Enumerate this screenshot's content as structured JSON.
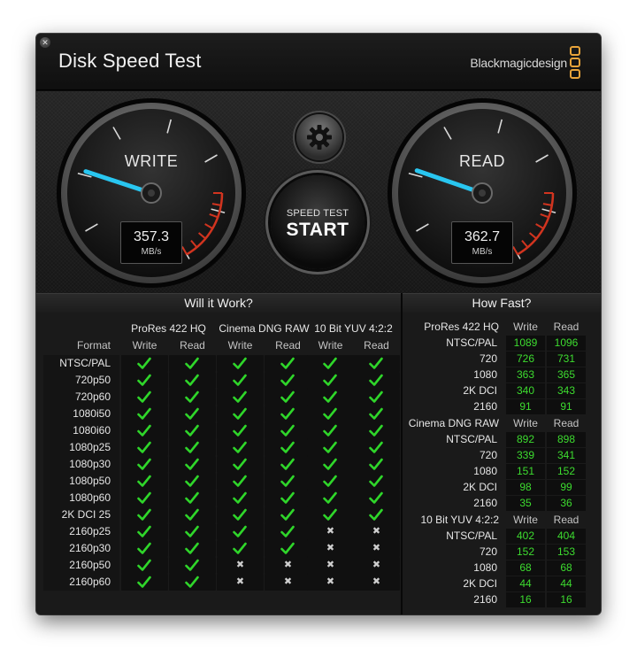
{
  "app": {
    "title": "Disk Speed Test",
    "brand": "Blackmagicdesign",
    "close_icon": "close-icon",
    "accent_needle": "#29c6f0",
    "redline_color": "#d1341f",
    "pass_color": "#2fd62a"
  },
  "gauges": {
    "write": {
      "label": "WRITE",
      "value": "357.3",
      "unit": "MB/s",
      "reading": 357.3
    },
    "read": {
      "label": "READ",
      "value": "362.7",
      "unit": "MB/s",
      "reading": 362.7
    }
  },
  "controls": {
    "settings_icon": "gear-icon",
    "start_sub": "SPEED TEST",
    "start_main": "START"
  },
  "will_it_work": {
    "title": "Will it Work?",
    "format_label": "Format",
    "groups": [
      "ProRes 422 HQ",
      "Cinema DNG RAW",
      "10 Bit YUV 4:2:2"
    ],
    "subheaders": [
      "Write",
      "Read"
    ],
    "rows": [
      {
        "format": "NTSC/PAL",
        "cells": [
          1,
          1,
          1,
          1,
          1,
          1
        ]
      },
      {
        "format": "720p50",
        "cells": [
          1,
          1,
          1,
          1,
          1,
          1
        ]
      },
      {
        "format": "720p60",
        "cells": [
          1,
          1,
          1,
          1,
          1,
          1
        ]
      },
      {
        "format": "1080i50",
        "cells": [
          1,
          1,
          1,
          1,
          1,
          1
        ]
      },
      {
        "format": "1080i60",
        "cells": [
          1,
          1,
          1,
          1,
          1,
          1
        ]
      },
      {
        "format": "1080p25",
        "cells": [
          1,
          1,
          1,
          1,
          1,
          1
        ]
      },
      {
        "format": "1080p30",
        "cells": [
          1,
          1,
          1,
          1,
          1,
          1
        ]
      },
      {
        "format": "1080p50",
        "cells": [
          1,
          1,
          1,
          1,
          1,
          1
        ]
      },
      {
        "format": "1080p60",
        "cells": [
          1,
          1,
          1,
          1,
          1,
          1
        ]
      },
      {
        "format": "2K DCI 25",
        "cells": [
          1,
          1,
          1,
          1,
          1,
          1
        ]
      },
      {
        "format": "2160p25",
        "cells": [
          1,
          1,
          1,
          1,
          0,
          0
        ]
      },
      {
        "format": "2160p30",
        "cells": [
          1,
          1,
          1,
          1,
          0,
          0
        ]
      },
      {
        "format": "2160p50",
        "cells": [
          1,
          1,
          0,
          0,
          0,
          0
        ]
      },
      {
        "format": "2160p60",
        "cells": [
          1,
          1,
          0,
          0,
          0,
          0
        ]
      }
    ]
  },
  "how_fast": {
    "title": "How Fast?",
    "groups": [
      {
        "name": "ProRes 422 HQ",
        "write_label": "Write",
        "read_label": "Read",
        "rows": [
          {
            "format": "NTSC/PAL",
            "write": "1089",
            "read": "1096"
          },
          {
            "format": "720",
            "write": "726",
            "read": "731"
          },
          {
            "format": "1080",
            "write": "363",
            "read": "365"
          },
          {
            "format": "2K DCI",
            "write": "340",
            "read": "343"
          },
          {
            "format": "2160",
            "write": "91",
            "read": "91"
          }
        ]
      },
      {
        "name": "Cinema DNG RAW",
        "write_label": "Write",
        "read_label": "Read",
        "rows": [
          {
            "format": "NTSC/PAL",
            "write": "892",
            "read": "898"
          },
          {
            "format": "720",
            "write": "339",
            "read": "341"
          },
          {
            "format": "1080",
            "write": "151",
            "read": "152"
          },
          {
            "format": "2K DCI",
            "write": "98",
            "read": "99"
          },
          {
            "format": "2160",
            "write": "35",
            "read": "36"
          }
        ]
      },
      {
        "name": "10 Bit YUV 4:2:2",
        "write_label": "Write",
        "read_label": "Read",
        "rows": [
          {
            "format": "NTSC/PAL",
            "write": "402",
            "read": "404"
          },
          {
            "format": "720",
            "write": "152",
            "read": "153"
          },
          {
            "format": "1080",
            "write": "68",
            "read": "68"
          },
          {
            "format": "2K DCI",
            "write": "44",
            "read": "44"
          },
          {
            "format": "2160",
            "write": "16",
            "read": "16"
          }
        ]
      }
    ]
  }
}
